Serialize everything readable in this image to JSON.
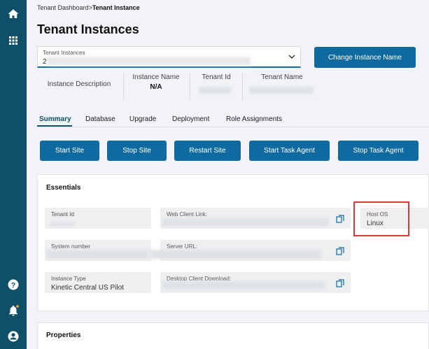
{
  "sidebar": {
    "items": [
      {
        "icon": "home-icon"
      },
      {
        "icon": "apps-grid-icon"
      },
      {
        "icon": "help-icon"
      },
      {
        "icon": "notifications-icon"
      },
      {
        "icon": "account-icon"
      }
    ]
  },
  "breadcrumb": {
    "parent": "Tenant Dashboard",
    "separator": ">",
    "current": "Tenant Instance"
  },
  "page": {
    "title": "Tenant Instances"
  },
  "instance_select": {
    "label": "Tenant Instances",
    "value": "2"
  },
  "buttons": {
    "change_name": "Change Instance Name"
  },
  "info": {
    "description_label": "Instance Description",
    "name_label": "Instance Name",
    "name_value": "N/A",
    "tenant_id_label": "Tenant Id",
    "tenant_name_label": "Tenant Name"
  },
  "tabs": [
    "Summary",
    "Database",
    "Upgrade",
    "Deployment",
    "Role Assignments"
  ],
  "actions": [
    "Start Site",
    "Stop Site",
    "Restart Site",
    "Start Task Agent",
    "Stop Task Agent"
  ],
  "essentials": {
    "title": "Essentials",
    "tenant_id_label": "Tenant Id",
    "web_client_label": "Web Client Link:",
    "host_os_label": "Host OS",
    "host_os_value": "Linux",
    "system_number_label": "System number",
    "server_url_label": "Server URL:",
    "instance_type_label": "Instance Type",
    "instance_type_value": "Kinetic Central US Pilot",
    "desktop_client_label": "Desktop Client Download:"
  },
  "properties": {
    "title": "Properties"
  },
  "colors": {
    "sidebar": "#0f5068",
    "accent": "#0f6aa0",
    "highlight": "#d9383a"
  }
}
